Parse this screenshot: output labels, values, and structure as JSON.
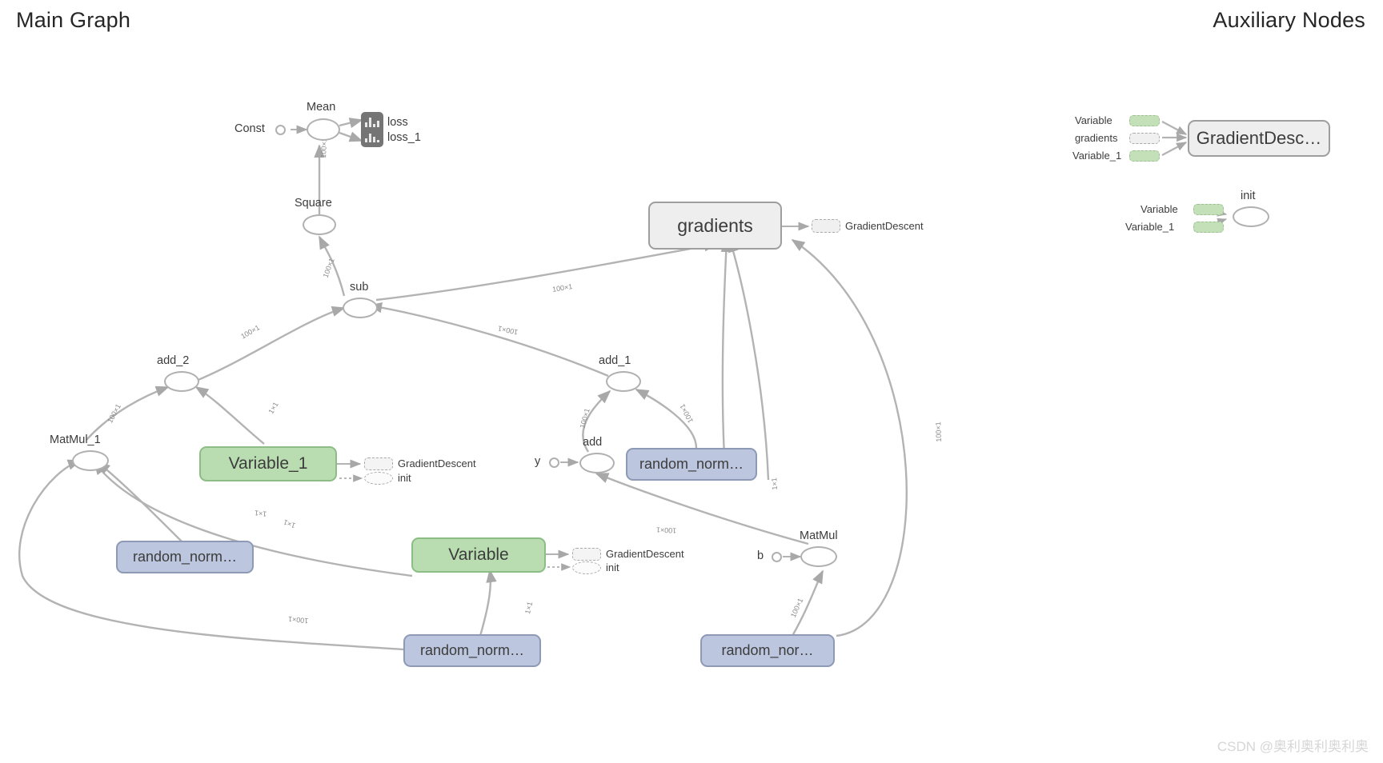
{
  "header": {
    "main_graph_title": "Main Graph",
    "aux_title": "Auxiliary Nodes"
  },
  "watermark": "CSDN @奥利奥利奥利奥",
  "colors": {
    "variable_green": "#b9ddb0",
    "random_blue": "#bcc6de",
    "group_grey": "#eeeeee",
    "summary_grey": "#757575",
    "edge_grey": "#b0b0b0",
    "text": "#3c3c3c"
  },
  "main_graph": {
    "nodes": [
      {
        "id": "const",
        "label": "Const",
        "shape": "small-circle"
      },
      {
        "id": "mean",
        "label": "Mean",
        "shape": "oval"
      },
      {
        "id": "summary",
        "label": "",
        "shape": "summary"
      },
      {
        "id": "loss",
        "label": "loss",
        "shape": "text"
      },
      {
        "id": "loss_1",
        "label": "loss_1",
        "shape": "text"
      },
      {
        "id": "square",
        "label": "Square",
        "shape": "oval"
      },
      {
        "id": "sub",
        "label": "sub",
        "shape": "oval"
      },
      {
        "id": "add_2",
        "label": "add_2",
        "shape": "oval"
      },
      {
        "id": "add_1",
        "label": "add_1",
        "shape": "oval"
      },
      {
        "id": "add",
        "label": "add",
        "shape": "oval"
      },
      {
        "id": "matmul_1",
        "label": "MatMul_1",
        "shape": "oval"
      },
      {
        "id": "matmul",
        "label": "MatMul",
        "shape": "oval"
      },
      {
        "id": "y",
        "label": "y",
        "shape": "small-circle"
      },
      {
        "id": "b",
        "label": "b",
        "shape": "small-circle"
      },
      {
        "id": "gradients",
        "label": "gradients",
        "shape": "rrect",
        "color": "grey"
      },
      {
        "id": "variable_1",
        "label": "Variable_1",
        "shape": "rrect",
        "color": "green"
      },
      {
        "id": "variable",
        "label": "Variable",
        "shape": "rrect",
        "color": "green"
      },
      {
        "id": "random_normal_a",
        "label": "random_norm…",
        "shape": "rrect",
        "color": "blue"
      },
      {
        "id": "random_normal_b",
        "label": "random_norm…",
        "shape": "rrect",
        "color": "blue"
      },
      {
        "id": "random_normal_c",
        "label": "random_norm…",
        "shape": "rrect",
        "color": "blue"
      },
      {
        "id": "random_normal_d",
        "label": "random_nor…",
        "shape": "rrect",
        "color": "blue"
      }
    ],
    "annotations": [
      {
        "id": "grad-gd",
        "label": "GradientDescent"
      },
      {
        "id": "v1-gd",
        "label": "GradientDescent"
      },
      {
        "id": "v1-init",
        "label": "init"
      },
      {
        "id": "v-gd",
        "label": "GradientDescent"
      },
      {
        "id": "v-init",
        "label": "init"
      }
    ],
    "edge_labels": [
      {
        "id": "e1",
        "text": "100×1"
      },
      {
        "id": "e2",
        "text": "100×1"
      },
      {
        "id": "e3",
        "text": "100×1"
      },
      {
        "id": "e4",
        "text": "100×1"
      },
      {
        "id": "e5",
        "text": "100×1"
      },
      {
        "id": "e6",
        "text": "100×1"
      },
      {
        "id": "e7",
        "text": "100×1"
      },
      {
        "id": "e8",
        "text": "100×1"
      },
      {
        "id": "e9",
        "text": "100×1"
      },
      {
        "id": "e10",
        "text": "100×1"
      },
      {
        "id": "e11",
        "text": "1×1"
      },
      {
        "id": "e12",
        "text": "1×1"
      },
      {
        "id": "e13",
        "text": "1×1"
      },
      {
        "id": "e14",
        "text": "1×1"
      },
      {
        "id": "e15",
        "text": "1×1"
      },
      {
        "id": "e16",
        "text": "100×1"
      },
      {
        "id": "e17",
        "text": "100×1"
      }
    ]
  },
  "auxiliary_nodes": {
    "gradient_descent_group": {
      "node_label": "GradientDesc…",
      "inputs": [
        {
          "label": "Variable",
          "fill": "green"
        },
        {
          "label": "gradients",
          "fill": "grey"
        },
        {
          "label": "Variable_1",
          "fill": "green"
        }
      ]
    },
    "init_group": {
      "node_label": "init",
      "inputs": [
        {
          "label": "Variable",
          "fill": "green"
        },
        {
          "label": "Variable_1",
          "fill": "green"
        }
      ]
    }
  }
}
